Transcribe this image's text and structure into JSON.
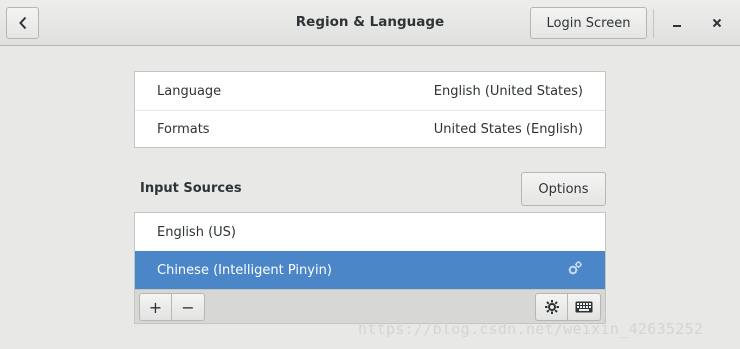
{
  "window": {
    "title": "Region & Language",
    "login_screen_label": "Login Screen"
  },
  "icons": {
    "back": "chevron-left-icon",
    "minimize": "minimize-icon",
    "close": "close-icon",
    "add": "plus-icon",
    "remove": "minus-icon",
    "settings": "gear-icon",
    "keyboard": "keyboard-icon"
  },
  "language_list": [
    {
      "label": "Language",
      "value": "English (United States)"
    },
    {
      "label": "Formats",
      "value": "United States (English)"
    }
  ],
  "input_sources": {
    "heading": "Input Sources",
    "options_label": "Options",
    "items": [
      {
        "label": "English (US)",
        "selected": false
      },
      {
        "label": "Chinese (Intelligent Pinyin)",
        "selected": true
      }
    ],
    "toolbar": {
      "add_symbol": "+",
      "remove_symbol": "−"
    }
  },
  "watermark": "https://blog.csdn.net/weixin_42635252",
  "colors": {
    "selection": "#4a86c8",
    "background": "#e8e8e7"
  }
}
